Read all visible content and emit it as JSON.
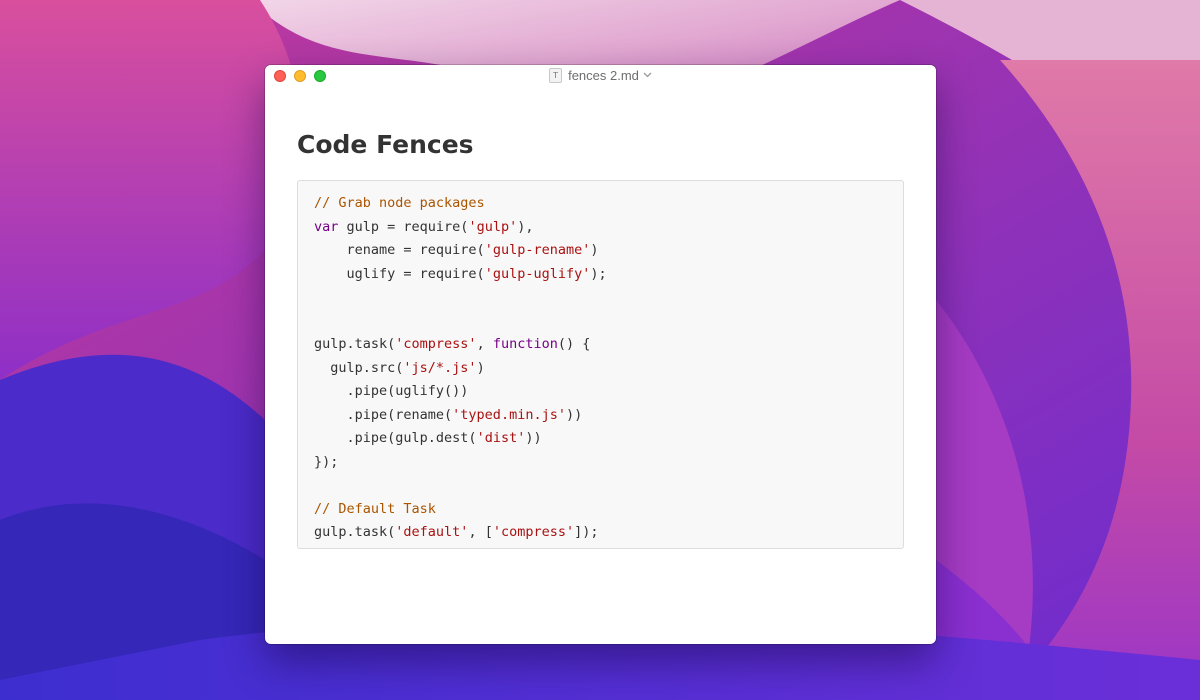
{
  "window": {
    "title": "fences 2.md",
    "doc_icon_glyph": "T"
  },
  "document": {
    "heading": "Code Fences",
    "code_lines": [
      [
        {
          "t": "comment",
          "s": "// Grab node packages"
        }
      ],
      [
        {
          "t": "keyword",
          "s": "var"
        },
        {
          "t": "plain",
          "s": " gulp = require("
        },
        {
          "t": "string",
          "s": "'gulp'"
        },
        {
          "t": "plain",
          "s": "),"
        }
      ],
      [
        {
          "t": "plain",
          "s": "    rename = require("
        },
        {
          "t": "string",
          "s": "'gulp-rename'"
        },
        {
          "t": "plain",
          "s": ")"
        }
      ],
      [
        {
          "t": "plain",
          "s": "    uglify = require("
        },
        {
          "t": "string",
          "s": "'gulp-uglify'"
        },
        {
          "t": "plain",
          "s": ");"
        }
      ],
      [],
      [],
      [
        {
          "t": "plain",
          "s": "gulp.task("
        },
        {
          "t": "string",
          "s": "'compress'"
        },
        {
          "t": "plain",
          "s": ", "
        },
        {
          "t": "keyword",
          "s": "function"
        },
        {
          "t": "plain",
          "s": "() {"
        }
      ],
      [
        {
          "t": "plain",
          "s": "  gulp.src("
        },
        {
          "t": "string",
          "s": "'js/*.js'"
        },
        {
          "t": "plain",
          "s": ")"
        }
      ],
      [
        {
          "t": "plain",
          "s": "    .pipe(uglify())"
        }
      ],
      [
        {
          "t": "plain",
          "s": "    .pipe(rename("
        },
        {
          "t": "string",
          "s": "'typed.min.js'"
        },
        {
          "t": "plain",
          "s": "))"
        }
      ],
      [
        {
          "t": "plain",
          "s": "    .pipe(gulp.dest("
        },
        {
          "t": "string",
          "s": "'dist'"
        },
        {
          "t": "plain",
          "s": "))"
        }
      ],
      [
        {
          "t": "plain",
          "s": "});"
        }
      ],
      [],
      [
        {
          "t": "comment",
          "s": "// Default Task"
        }
      ],
      [
        {
          "t": "plain",
          "s": "gulp.task("
        },
        {
          "t": "string",
          "s": "'default'"
        },
        {
          "t": "plain",
          "s": ", ["
        },
        {
          "t": "string",
          "s": "'compress'"
        },
        {
          "t": "plain",
          "s": "]);"
        }
      ]
    ]
  },
  "colors": {
    "comment": "#aa5500",
    "keyword": "#770088",
    "string": "#aa1111",
    "plain": "#333333",
    "close": "#fe5f57",
    "minimize": "#febc2e",
    "zoom": "#28c840"
  }
}
